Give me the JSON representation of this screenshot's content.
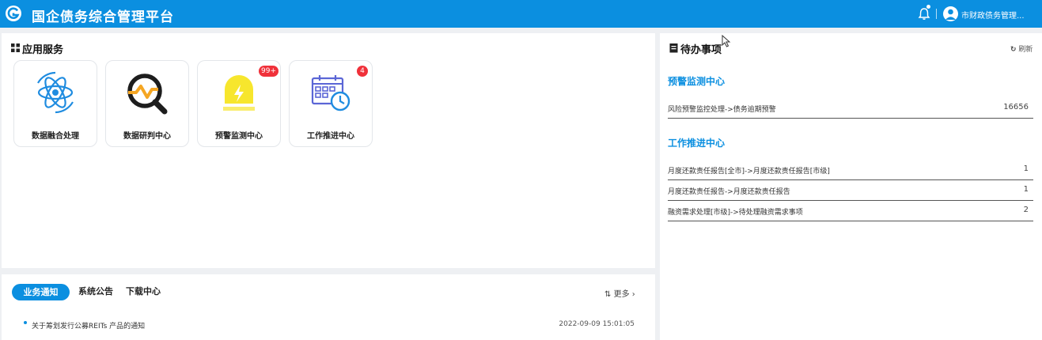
{
  "header": {
    "title": "国企债务综合管理平台",
    "user": "市财政债务管理...",
    "logo_icon": "g-logo-icon",
    "bell_icon": "bell-icon",
    "avatar_icon": "user-avatar-icon"
  },
  "apps": {
    "title": "应用服务",
    "cards": [
      {
        "label": "数据融合处理",
        "icon": "atom-icon",
        "badge": ""
      },
      {
        "label": "数据研判中心",
        "icon": "magnifier-chart-icon",
        "badge": ""
      },
      {
        "label": "预警监测中心",
        "icon": "alarm-lamp-icon",
        "badge": "99+"
      },
      {
        "label": "工作推进中心",
        "icon": "calendar-clock-icon",
        "badge": "4"
      }
    ]
  },
  "notice": {
    "tabs": [
      "业务通知",
      "系统公告",
      "下载中心"
    ],
    "active_tab": "业务通知",
    "more": "更多",
    "items": [
      {
        "text": "关于筹划发行公募REITs 产品的通知",
        "time": "2022-09-09 15:01:05"
      }
    ]
  },
  "todo": {
    "title": "待办事项",
    "refresh": "刷新",
    "groups": [
      {
        "title": "预警监测中心",
        "rows": [
          {
            "text": "风险预警监控处理->债务逾期预警",
            "count": "16656"
          }
        ]
      },
      {
        "title": "工作推进中心",
        "rows": [
          {
            "text": "月度还款责任报告[全市]->月度还款责任报告[市级]",
            "count": "1"
          },
          {
            "text": "月度还款责任报告->月度还款责任报告",
            "count": "1"
          },
          {
            "text": "融资需求处理[市级]->待处理融资需求事项",
            "count": "2"
          }
        ]
      }
    ]
  },
  "colors": {
    "primary": "#0b8fe0",
    "badge": "#f0313a",
    "background": "#eef0f3"
  }
}
